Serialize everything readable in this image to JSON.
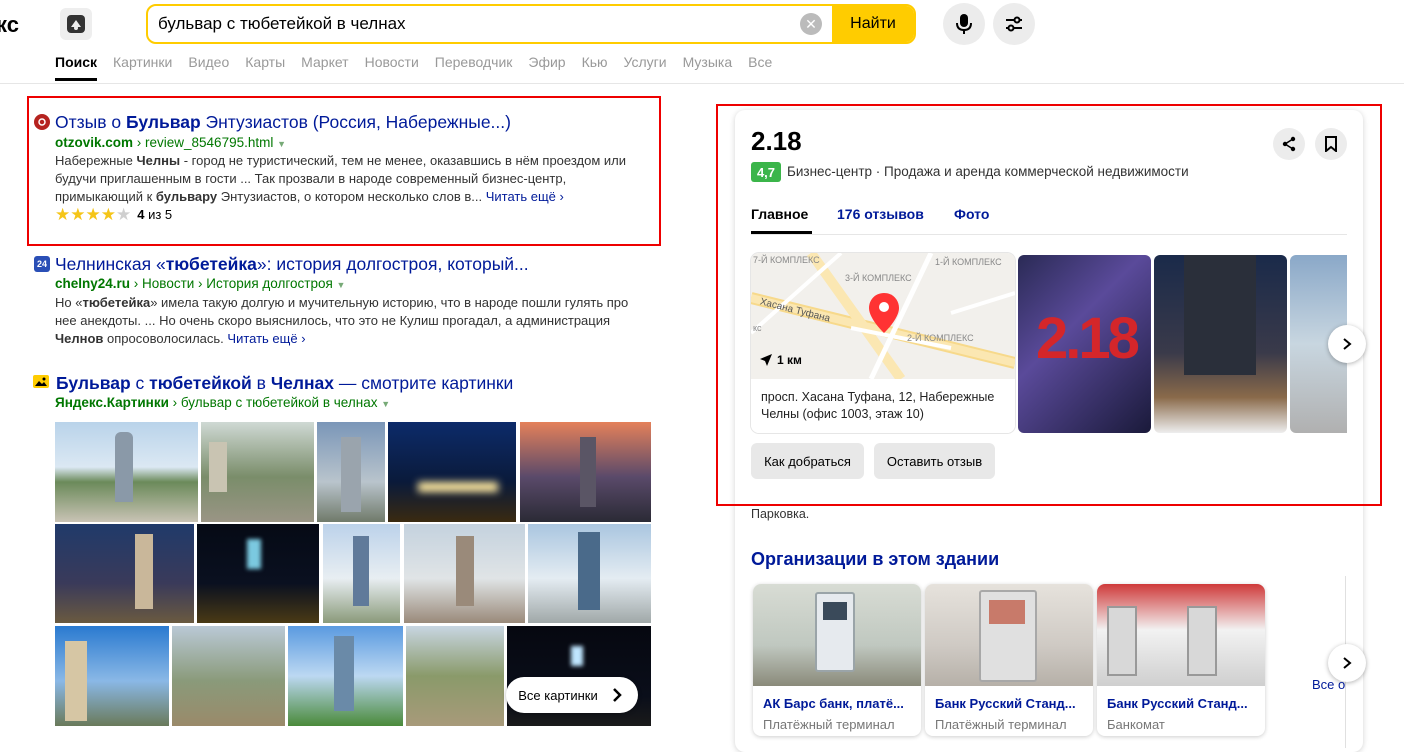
{
  "header": {
    "logo_text": "кс",
    "search_value": "бульвар с тюбетейкой в челнах",
    "find_label": "Найти",
    "nav": [
      "Поиск",
      "Картинки",
      "Видео",
      "Карты",
      "Маркет",
      "Новости",
      "Переводчик",
      "Эфир",
      "Кью",
      "Услуги",
      "Музыка",
      "Все"
    ]
  },
  "results": [
    {
      "title_pre": "Отзыв о ",
      "title_bold": "Бульвар",
      "title_post": " Энтузиастов (Россия, Набережные...)",
      "url_domain": "otzovik.com",
      "url_path": " › review_8546795.html",
      "snippet_1": "Набережные ",
      "snippet_1b": "Челны",
      "snippet_1c": " - город не туристический, тем не менее, оказавшись в нём проездом или",
      "snippet_2": "будучи приглашенным в гости ... Так прозвали в народе современный бизнес-центр,",
      "snippet_3": "примыкающий к ",
      "snippet_3b": "бульвару",
      "snippet_3c": " Энтузиастов, о котором несколько слов в...",
      "read_more": "Читать ещё ›",
      "rating_value": "4",
      "rating_suffix": " из 5",
      "rating_fraction": 0.8
    },
    {
      "title_pre": "Челнинская «",
      "title_bold": "тюбетейка",
      "title_post": "»: история долгостроя, который...",
      "url_domain": "chelny24.ru",
      "url_path": " › Новости › История долгостроя",
      "snippet_1": "Но «",
      "snippet_1b": "тюбетейка",
      "snippet_1c": "» имела такую долгую и мучительную историю, что в народе пошли гулять про",
      "snippet_2": "нее анекдоты. ... Но очень скоро выяснилось, что это не Кулиш прогадал, а администрация",
      "snippet_3b": "Челнов",
      "snippet_3c": " опросоволосилась.",
      "read_more": "Читать ещё ›",
      "favicon_text": "24"
    },
    {
      "title_b1": "Бульвар",
      "title_t1": " с ",
      "title_b2": "тюбетейкой",
      "title_t2": " в ",
      "title_b3": "Челнах",
      "title_t3": " — смотрите картинки",
      "url_domain": "Яндекс.Картинки",
      "url_path": " › бульвар с тюбетейкой в челнах",
      "all_images": "Все картинки"
    }
  ],
  "org": {
    "name": "2.18",
    "rating": "4,7",
    "category": "Бизнес-центр · Продажа и аренда коммерческой недвижимости",
    "tabs": [
      "Главное",
      "176 отзывов",
      "Фото"
    ],
    "map_labels": [
      "7-Й КОМПЛЕКС",
      "3-Й КОМПЛЕКС",
      "1-Й КОМПЛЕКС",
      "2-Й КОМПЛЕКС",
      "Хасана Туфана",
      "кс"
    ],
    "distance": "1 км",
    "address": "просп. Хасана Туфана, 12, Набережные Челны (офис 1003, этаж 10)",
    "btn_route": "Как добраться",
    "btn_review": "Оставить отзыв",
    "parking": "Парковка.",
    "photo_sign": "2.18",
    "in_building_title": "Организации в этом здании",
    "orgs": [
      {
        "name": "АК Барс банк, платё...",
        "type": "Платёжный терминал"
      },
      {
        "name": "Банк Русский Станд...",
        "type": "Платёжный терминал"
      },
      {
        "name": "Банк Русский Станд...",
        "type": "Банкомат"
      }
    ],
    "see_all": "Все о"
  },
  "colors": {
    "accent": "#ffcc00",
    "link": "#001a99",
    "url": "#007700",
    "rating_green": "#3bb54a",
    "highlight_red": "#e00000"
  }
}
